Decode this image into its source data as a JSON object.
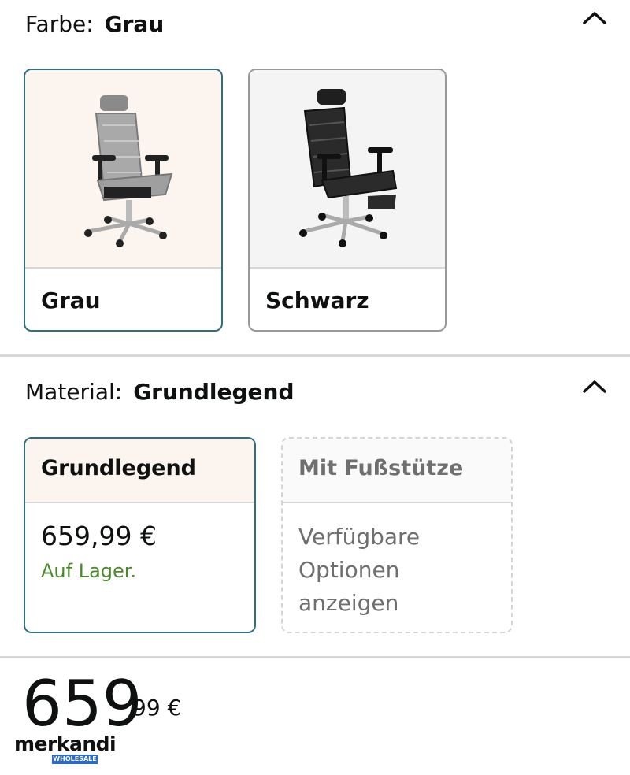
{
  "color_section": {
    "label": "Farbe:",
    "value": "Grau",
    "swatches": [
      {
        "name": "Grau",
        "selected": true
      },
      {
        "name": "Schwarz",
        "selected": false
      }
    ]
  },
  "material_section": {
    "label": "Material:",
    "value": "Grundlegend",
    "options": [
      {
        "title": "Grundlegend",
        "price": "659,99 €",
        "stock": "Auf Lager.",
        "selected": true
      },
      {
        "title": "Mit Fußstütze",
        "desc_lines": [
          "Verfügbare",
          "Optionen",
          "anzeigen"
        ],
        "selected": false
      }
    ]
  },
  "price": {
    "whole": "659",
    "cents": "99 €"
  },
  "watermark": {
    "word": "merkandi",
    "tag": "WHOLESALE"
  },
  "colors": {
    "selected_border": "#2f6f84",
    "in_stock": "#4a8a2a"
  }
}
